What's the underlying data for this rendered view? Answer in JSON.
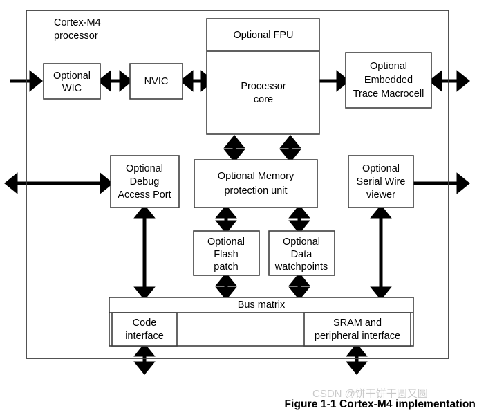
{
  "figure": {
    "caption": "Figure 1-1 Cortex-M4 implementation",
    "watermark": "CSDN @饼干饼干圆又圆",
    "frame_label_line1": "Cortex-M4",
    "frame_label_line2": "processor"
  },
  "colors": {
    "background": "#ffffff",
    "box_stroke": "#3f3f3f",
    "frame_stroke": "#3f3f3f",
    "arrow": "#000000",
    "text": "#000000",
    "watermark": "#c9c9c9"
  },
  "blocks": {
    "wic": {
      "line1": "Optional",
      "line2": "WIC"
    },
    "nvic": {
      "line1": "NVIC"
    },
    "fpu": {
      "line1": "Optional FPU"
    },
    "core": {
      "line1": "Processor",
      "line2": "core"
    },
    "etm": {
      "line1": "Optional",
      "line2": "Embedded",
      "line3": "Trace Macrocell"
    },
    "dap": {
      "line1": "Optional",
      "line2": "Debug",
      "line3": "Access Port"
    },
    "mpu": {
      "line1": "Optional Memory",
      "line2": "protection unit"
    },
    "swv": {
      "line1": "Optional",
      "line2": "Serial Wire",
      "line3": "viewer"
    },
    "flash_patch": {
      "line1": "Optional",
      "line2": "Flash",
      "line3": "patch"
    },
    "data_watchpoints": {
      "line1": "Optional",
      "line2": "Data",
      "line3": "watchpoints"
    },
    "bus_matrix": {
      "line1": "Bus matrix"
    },
    "code_interface": {
      "line1": "Code",
      "line2": "interface"
    },
    "sram_interface": {
      "line1": "SRAM and",
      "line2": "peripheral interface"
    }
  }
}
